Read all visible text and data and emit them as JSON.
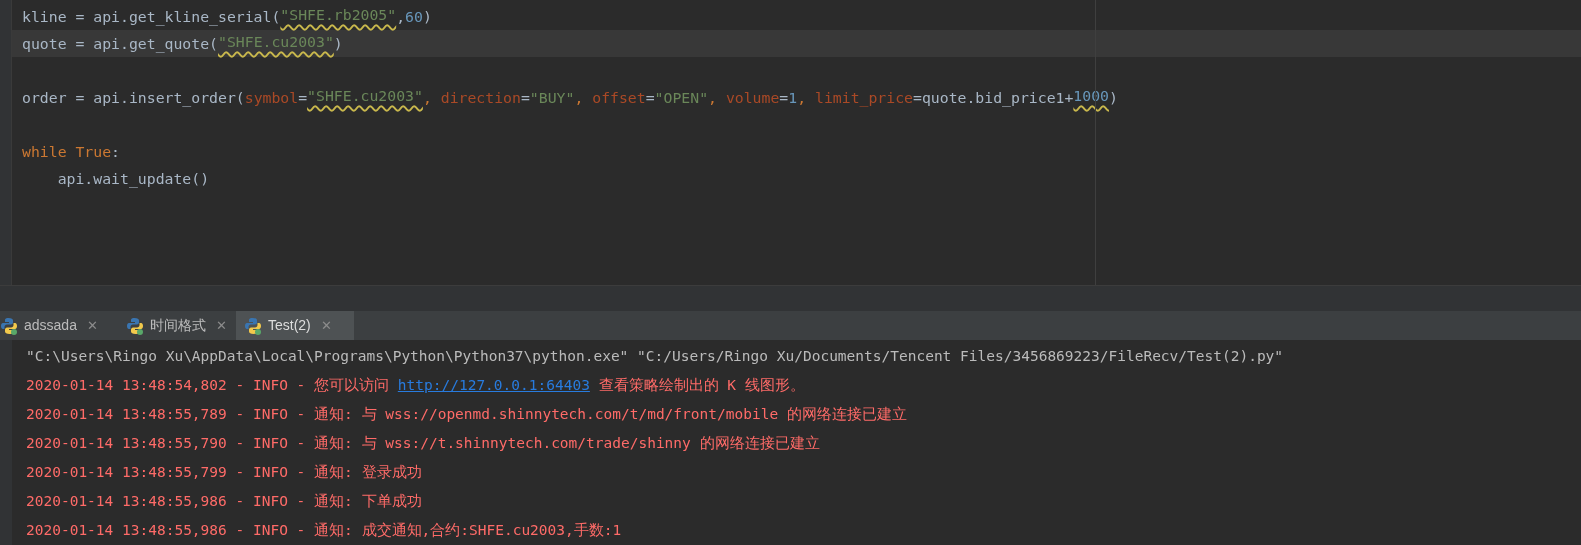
{
  "editor": {
    "lines": [
      {
        "current": false,
        "tokens": [
          {
            "kind": "plain",
            "text": "kline = api.get_kline_serial("
          },
          {
            "kind": "string",
            "text": "\"SHFE.rb2005\"",
            "warn": true
          },
          {
            "kind": "plain",
            "text": ","
          },
          {
            "kind": "number",
            "text": "60"
          },
          {
            "kind": "plain",
            "text": ")"
          }
        ]
      },
      {
        "current": true,
        "tokens": [
          {
            "kind": "plain",
            "text": "quote = api.get_quote("
          },
          {
            "kind": "string",
            "text": "\"SHFE.cu2003\"",
            "warn": true
          },
          {
            "kind": "plain",
            "text": ")"
          }
        ]
      },
      {
        "current": false
      },
      {
        "current": false,
        "tokens": [
          {
            "kind": "plain",
            "text": "order = api.insert_order("
          },
          {
            "kind": "param",
            "text": "symbol"
          },
          {
            "kind": "plain",
            "text": "="
          },
          {
            "kind": "string",
            "text": "\"SHFE.cu2003\"",
            "warn": true
          },
          {
            "kind": "keyword",
            "text": ", "
          },
          {
            "kind": "param",
            "text": "direction"
          },
          {
            "kind": "plain",
            "text": "="
          },
          {
            "kind": "string",
            "text": "\"BUY\""
          },
          {
            "kind": "keyword",
            "text": ", "
          },
          {
            "kind": "param",
            "text": "offset"
          },
          {
            "kind": "plain",
            "text": "="
          },
          {
            "kind": "string",
            "text": "\"OPEN\""
          },
          {
            "kind": "keyword",
            "text": ", "
          },
          {
            "kind": "param",
            "text": "volume"
          },
          {
            "kind": "plain",
            "text": "="
          },
          {
            "kind": "number",
            "text": "1"
          },
          {
            "kind": "keyword",
            "text": ", "
          },
          {
            "kind": "param",
            "text": "limit_price"
          },
          {
            "kind": "plain",
            "text": "=quote.bid_price1+"
          },
          {
            "kind": "number",
            "text": "1000",
            "warn": true
          },
          {
            "kind": "plain",
            "text": ")"
          }
        ]
      },
      {
        "current": false
      },
      {
        "current": false,
        "tokens": [
          {
            "kind": "keyword",
            "text": "while True"
          },
          {
            "kind": "plain",
            "text": ":"
          }
        ]
      },
      {
        "current": false,
        "tokens": [
          {
            "kind": "plain",
            "text": "    api.wait_update()"
          }
        ]
      }
    ]
  },
  "tabs": [
    {
      "label": "adssada",
      "selected": false,
      "close": "✕"
    },
    {
      "label": "时间格式",
      "selected": false,
      "close": "✕"
    },
    {
      "label": "Test(2)",
      "selected": true,
      "close": "✕"
    }
  ],
  "console": [
    {
      "kind": "command",
      "text": "\"C:\\Users\\Ringo Xu\\AppData\\Local\\Programs\\Python\\Python37\\python.exe\" \"C:/Users/Ringo Xu/Documents/Tencent Files/3456869223/FileRecv/Test(2).py\""
    },
    {
      "kind": "log",
      "text": "2020-01-14 13:48:54,802 - INFO - 您可以访问 ",
      "link": "http://127.0.0.1:64403",
      "after": " 查看策略绘制出的 K 线图形。"
    },
    {
      "kind": "log",
      "text": "2020-01-14 13:48:55,789 - INFO - 通知: 与 wss://openmd.shinnytech.com/t/md/front/mobile 的网络连接已建立"
    },
    {
      "kind": "log",
      "text": "2020-01-14 13:48:55,790 - INFO - 通知: 与 wss://t.shinnytech.com/trade/shinny 的网络连接已建立"
    },
    {
      "kind": "log",
      "text": "2020-01-14 13:48:55,799 - INFO - 通知: 登录成功"
    },
    {
      "kind": "log",
      "text": "2020-01-14 13:48:55,986 - INFO - 通知: 下单成功"
    },
    {
      "kind": "log",
      "text": "2020-01-14 13:48:55,986 - INFO - 通知: 成交通知,合约:SHFE.cu2003,手数:1"
    }
  ]
}
